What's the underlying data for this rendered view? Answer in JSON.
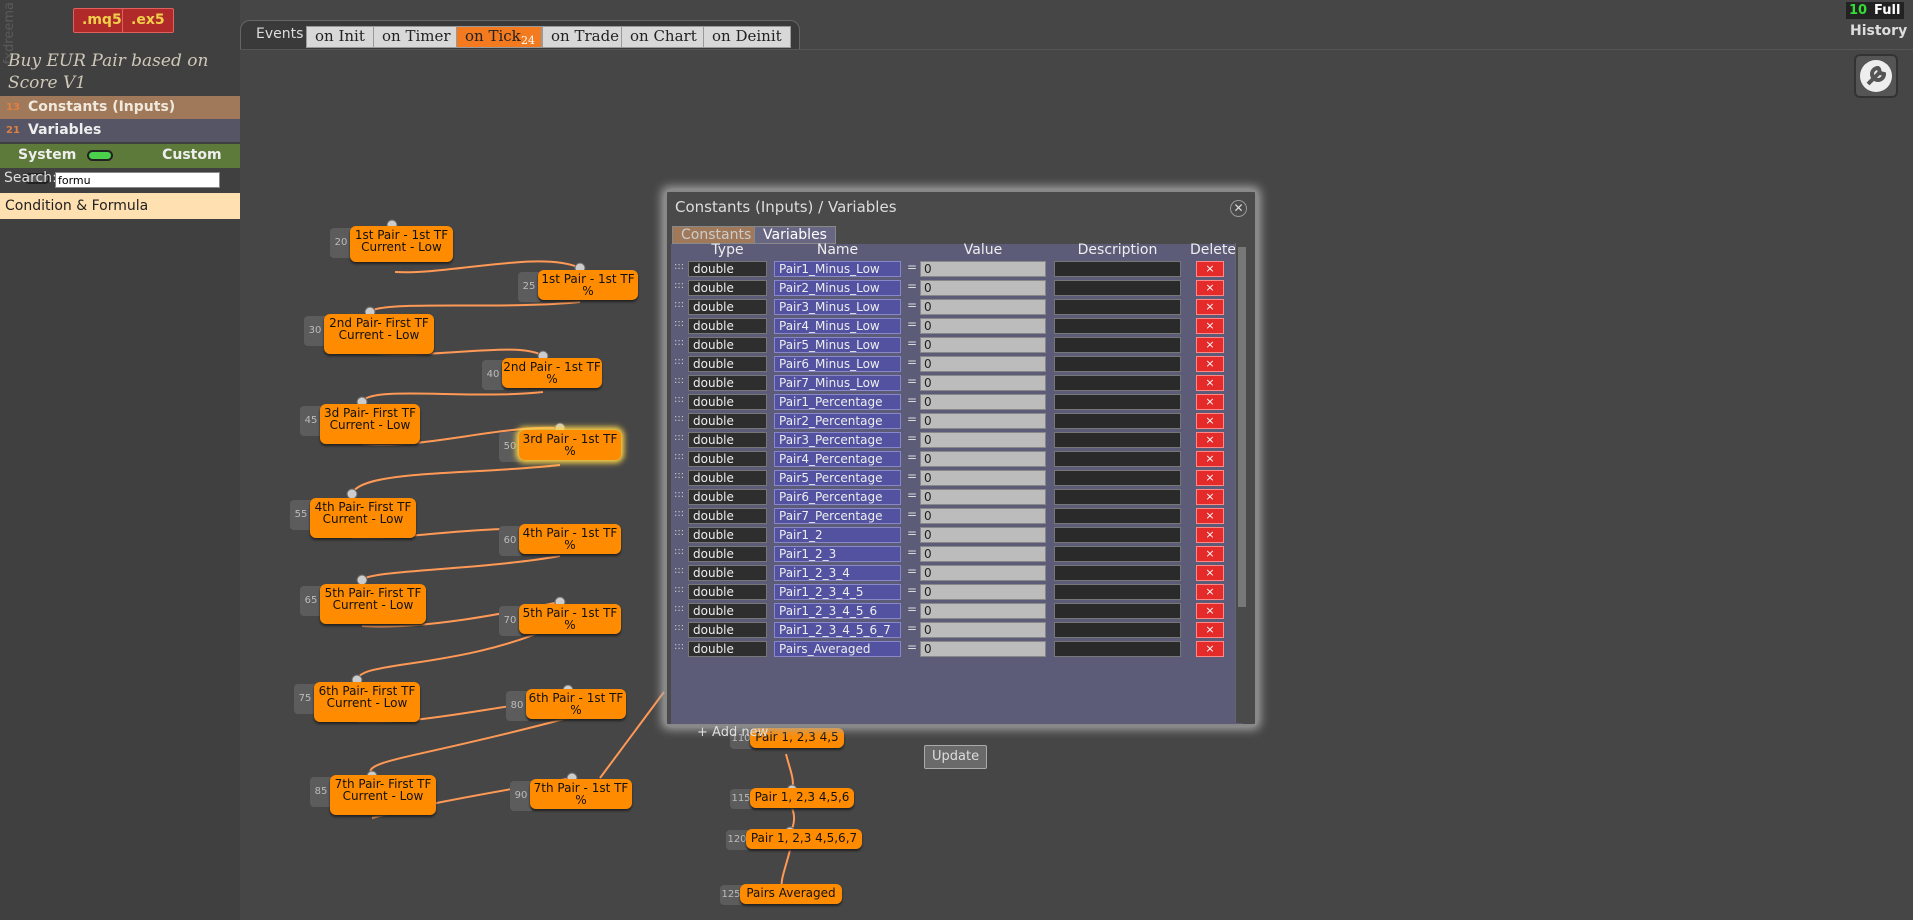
{
  "brand": "fxdreema",
  "exports": [
    "mq5",
    "ex5"
  ],
  "project_title": "Buy EUR Pair based on Score V1",
  "left_panel": {
    "constants": {
      "count": "13",
      "label": "Constants (Inputs)"
    },
    "variables": {
      "count": "21",
      "label": "Variables"
    },
    "system_label": "System",
    "custom_label": "Custom",
    "search_label": "Search:",
    "search_value": "formu",
    "category": "Condition & Formula"
  },
  "tabs": {
    "label": "Events",
    "items": [
      "on Init",
      "on Timer",
      "on Tick",
      "on Trade",
      "on Chart",
      "on Deinit"
    ],
    "active": "on Tick",
    "badge": "24"
  },
  "history": {
    "count": "10",
    "full": "Full",
    "label": "History"
  },
  "settings_icon": "wrench-icon",
  "nodes": [
    {
      "num": "20",
      "text": "1st  Pair - 1st TF Current - Low"
    },
    {
      "num": "25",
      "text": "1st Pair - 1st TF %"
    },
    {
      "num": "30",
      "text": "2nd Pair- First TF Current - Low"
    },
    {
      "num": "40",
      "text": "2nd Pair - 1st TF %"
    },
    {
      "num": "45",
      "text": "3d Pair- First TF Current - Low"
    },
    {
      "num": "50",
      "text": "3rd Pair - 1st TF %"
    },
    {
      "num": "55",
      "text": "4th Pair- First TF Current - Low"
    },
    {
      "num": "60",
      "text": "4th Pair - 1st TF %"
    },
    {
      "num": "65",
      "text": "5th Pair- First TF Current - Low"
    },
    {
      "num": "70",
      "text": "5th Pair - 1st TF %"
    },
    {
      "num": "75",
      "text": "6th Pair- First TF Current - Low"
    },
    {
      "num": "80",
      "text": "6th Pair - 1st TF %"
    },
    {
      "num": "85",
      "text": "7th Pair- First TF Current - Low"
    },
    {
      "num": "90",
      "text": "7th Pair - 1st TF %"
    },
    {
      "num": "110",
      "text": "Pair 1, 2,3 4,5"
    },
    {
      "num": "115",
      "text": "Pair 1, 2,3 4,5,6"
    },
    {
      "num": "120",
      "text": "Pair 1, 2,3 4,5,6,7"
    },
    {
      "num": "125",
      "text": "Pairs Averaged"
    }
  ],
  "modal": {
    "title": "Constants (Inputs) / Variables",
    "tab_constants": "Constants",
    "tab_variables": "Variables",
    "headers": {
      "type": "Type",
      "name": "Name",
      "value": "Value",
      "description": "Description",
      "delete": "Delete"
    },
    "rows": [
      {
        "type": "double",
        "name": "Pair1_Minus_Low",
        "value": "0"
      },
      {
        "type": "double",
        "name": "Pair2_Minus_Low",
        "value": "0"
      },
      {
        "type": "double",
        "name": "Pair3_Minus_Low",
        "value": "0"
      },
      {
        "type": "double",
        "name": "Pair4_Minus_Low",
        "value": "0"
      },
      {
        "type": "double",
        "name": "Pair5_Minus_Low",
        "value": "0"
      },
      {
        "type": "double",
        "name": "Pair6_Minus_Low",
        "value": "0"
      },
      {
        "type": "double",
        "name": "Pair7_Minus_Low",
        "value": "0"
      },
      {
        "type": "double",
        "name": "Pair1_Percentage",
        "value": "0"
      },
      {
        "type": "double",
        "name": "Pair2_Percentage",
        "value": "0"
      },
      {
        "type": "double",
        "name": "Pair3_Percentage",
        "value": "0"
      },
      {
        "type": "double",
        "name": "Pair4_Percentage",
        "value": "0"
      },
      {
        "type": "double",
        "name": "Pair5_Percentage",
        "value": "0"
      },
      {
        "type": "double",
        "name": "Pair6_Percentage",
        "value": "0"
      },
      {
        "type": "double",
        "name": "Pair7_Percentage",
        "value": "0"
      },
      {
        "type": "double",
        "name": "Pair1_2",
        "value": "0"
      },
      {
        "type": "double",
        "name": "Pair1_2_3",
        "value": "0"
      },
      {
        "type": "double",
        "name": "Pair1_2_3_4",
        "value": "0"
      },
      {
        "type": "double",
        "name": "Pair1_2_3_4_5",
        "value": "0"
      },
      {
        "type": "double",
        "name": "Pair1_2_3_4_5_6",
        "value": "0"
      },
      {
        "type": "double",
        "name": "Pair1_2_3_4_5_6_7",
        "value": "0"
      },
      {
        "type": "double",
        "name": "Pairs_Averaged",
        "value": "0"
      }
    ],
    "delete_glyph": "×",
    "add_new": "+ Add new",
    "update": "Update"
  },
  "colors": {
    "node": "#ff8c00",
    "wire": "#ff9955",
    "active_tab": "#f37a1f",
    "delete": "#e52a2a"
  }
}
